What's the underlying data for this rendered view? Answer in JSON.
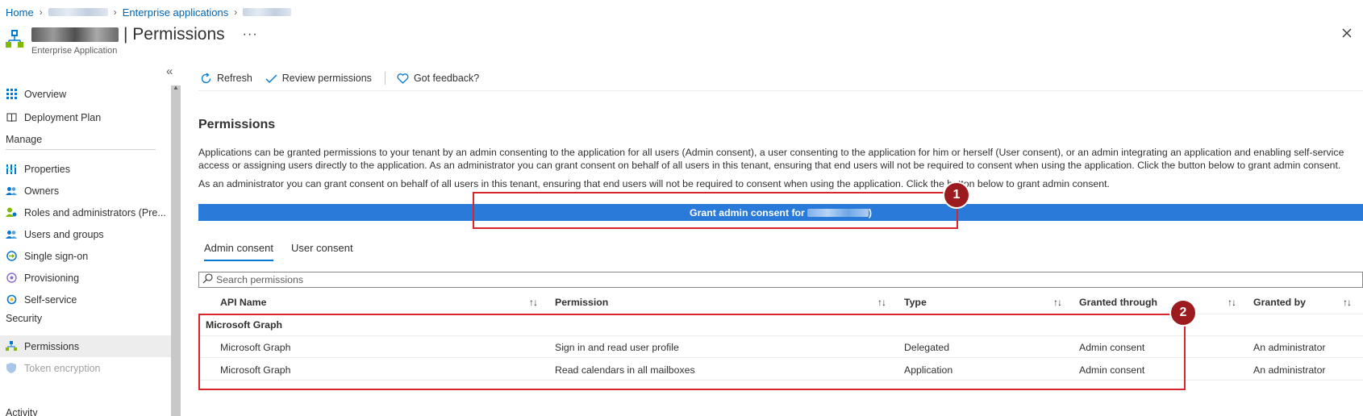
{
  "breadcrumb": {
    "home": "Home",
    "enterprise_apps": "Enterprise applications"
  },
  "header": {
    "title": "| Permissions",
    "more": "···",
    "subtitle": "Enterprise Application"
  },
  "sidebar": {
    "items": [
      {
        "label": "Overview",
        "icon": "grid-icon"
      },
      {
        "label": "Deployment Plan",
        "icon": "book-icon"
      }
    ],
    "manage_heading": "Manage",
    "manage_items": [
      {
        "label": "Properties",
        "icon": "properties-icon"
      },
      {
        "label": "Owners",
        "icon": "users-icon"
      },
      {
        "label": "Roles and administrators (Pre...",
        "icon": "roles-icon"
      },
      {
        "label": "Users and groups",
        "icon": "users-groups-icon"
      },
      {
        "label": "Single sign-on",
        "icon": "sso-icon"
      },
      {
        "label": "Provisioning",
        "icon": "provisioning-icon"
      },
      {
        "label": "Self-service",
        "icon": "self-service-icon"
      }
    ],
    "security_heading": "Security",
    "security_items": [
      {
        "label": "Permissions",
        "icon": "permissions-icon",
        "active": true
      },
      {
        "label": "Token encryption",
        "icon": "shield-icon",
        "disabled": true
      }
    ],
    "activity_heading": "Activity"
  },
  "toolbar": {
    "refresh": "Refresh",
    "review": "Review permissions",
    "feedback": "Got feedback?"
  },
  "main": {
    "section_title": "Permissions",
    "description_1": "Applications can be granted permissions to your tenant by an admin consenting to the application for all users (Admin consent), a user consenting to the application for him or herself (User consent), or an admin integrating an application and enabling self-service access or assigning users directly to the application. As an administrator you can grant consent on behalf of all users in this tenant, ensuring that end users will not be required to consent when using the application. Click the button below to grant admin consent.",
    "description_2": "As an administrator you can grant consent on behalf of all users in this tenant, ensuring that end users will not be required to consent when using the application. Click the button below to grant admin consent.",
    "grant_button": "Grant admin consent for",
    "badge_1": "1",
    "badge_2": "2",
    "tabs": [
      {
        "label": "Admin consent",
        "active": true
      },
      {
        "label": "User consent",
        "active": false
      }
    ],
    "search_placeholder": "Search permissions",
    "columns": [
      "API Name",
      "Permission",
      "Type",
      "Granted through",
      "Granted by"
    ],
    "group_name": "Microsoft Graph",
    "rows": [
      {
        "api": "Microsoft Graph",
        "permission": "Sign in and read user profile",
        "type": "Delegated",
        "granted_through": "Admin consent",
        "granted_by": "An administrator"
      },
      {
        "api": "Microsoft Graph",
        "permission": "Read calendars in all mailboxes",
        "type": "Application",
        "granted_through": "Admin consent",
        "granted_by": "An administrator"
      }
    ]
  },
  "colors": {
    "link": "#0065b3",
    "primary_button": "#2a7bd9",
    "highlight": "#d9262b",
    "badge": "#9b1b1e",
    "tab_underline": "#0078d4"
  }
}
